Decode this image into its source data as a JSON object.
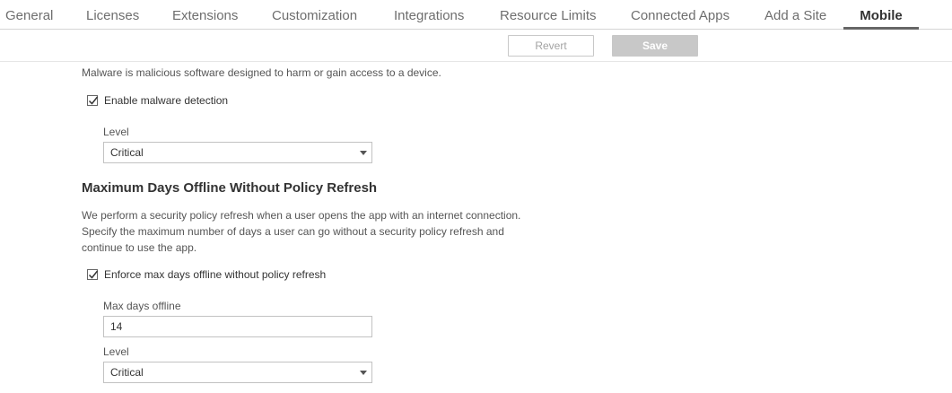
{
  "tabs": [
    {
      "label": "General"
    },
    {
      "label": "Licenses"
    },
    {
      "label": "Extensions"
    },
    {
      "label": "Customization"
    },
    {
      "label": "Integrations"
    },
    {
      "label": "Resource Limits"
    },
    {
      "label": "Connected Apps"
    },
    {
      "label": "Add a Site"
    },
    {
      "label": "Mobile"
    }
  ],
  "toolbar": {
    "revert_label": "Revert",
    "save_label": "Save"
  },
  "malware": {
    "description": "Malware is malicious software designed to harm or gain access to a device.",
    "checkbox_label": "Enable malware detection",
    "checked": true,
    "level_label": "Level",
    "level_value": "Critical"
  },
  "offline": {
    "heading": "Maximum Days Offline Without Policy Refresh",
    "description": "We perform a security policy refresh when a user opens the app with an internet connection. Specify the maximum number of days a user can go without a security policy refresh and continue to use the app.",
    "checkbox_label": "Enforce max days offline without policy refresh",
    "checked": true,
    "max_days_label": "Max days offline",
    "max_days_value": "14",
    "level_label": "Level",
    "level_value": "Critical"
  }
}
